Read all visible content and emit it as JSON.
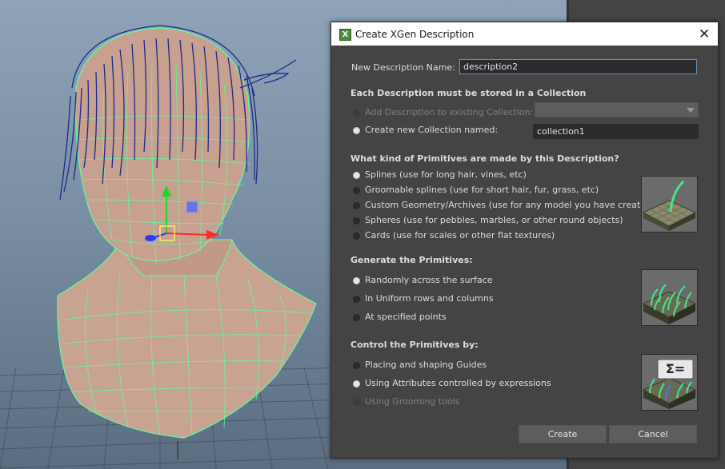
{
  "dialog": {
    "title": "Create XGen Description",
    "app_icon_letter": "X",
    "new_description_label": "New Description Name:",
    "new_description_value": "description2",
    "collection_header": "Each Description must be stored in a Collection",
    "collection_options": [
      {
        "label": "Add Description to existing Collection:",
        "selected": false,
        "enabled": false
      },
      {
        "label": "Create new Collection named:",
        "selected": true,
        "enabled": true
      }
    ],
    "collection_name_value": "collection1",
    "primitives_header": "What kind of Primitives are made by this Description?",
    "primitive_options": [
      {
        "label": "Splines (use for long hair, vines, etc)",
        "selected": true
      },
      {
        "label": "Groomable splines (use for short hair, fur, grass, etc)",
        "selected": false
      },
      {
        "label": "Custom Geometry/Archives (use for any model you have created)",
        "selected": false
      },
      {
        "label": "Spheres (use for pebbles, marbles, or other round objects)",
        "selected": false
      },
      {
        "label": "Cards (use for scales or other flat textures)",
        "selected": false
      }
    ],
    "generate_header": "Generate the Primitives:",
    "generate_options": [
      {
        "label": "Randomly across the surface",
        "selected": true
      },
      {
        "label": "In Uniform rows and columns",
        "selected": false
      },
      {
        "label": "At specified points",
        "selected": false
      }
    ],
    "control_header": "Control the Primitives by:",
    "control_options": [
      {
        "label": "Placing and shaping Guides",
        "selected": false,
        "enabled": true
      },
      {
        "label": "Using Attributes controlled by expressions",
        "selected": true,
        "enabled": true
      },
      {
        "label": "Using Grooming tools",
        "selected": false,
        "enabled": false
      }
    ],
    "expression_icon_text": "Σ=",
    "create_label": "Create",
    "cancel_label": "Cancel"
  },
  "colors": {
    "dialog_bg": "#444444",
    "wireframe": "#5dff9e",
    "hair": "#1c2a8a",
    "skin": "#c89f8e",
    "focus_border": "#5b93c8"
  }
}
